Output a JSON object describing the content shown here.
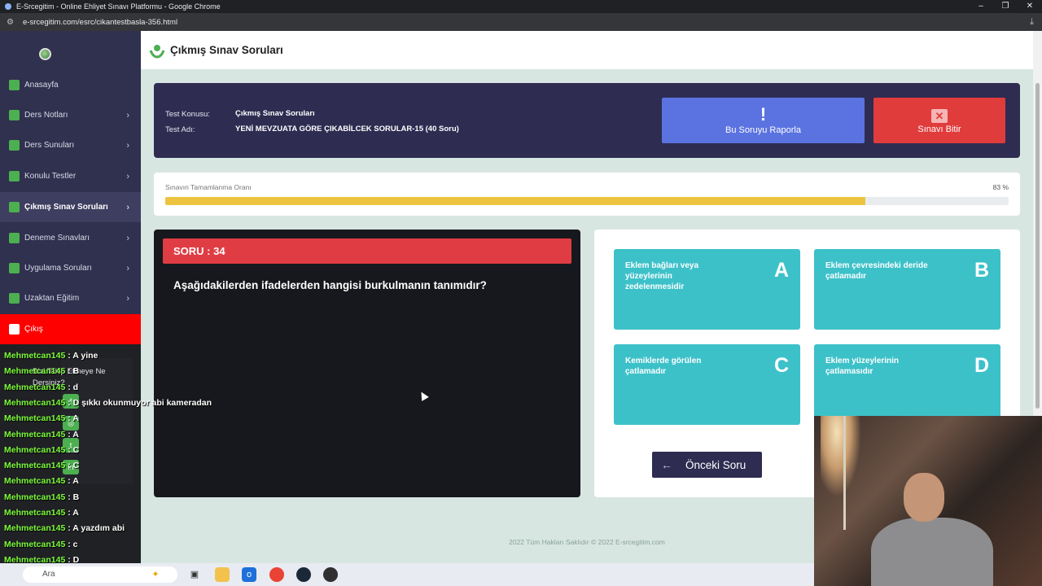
{
  "browser": {
    "window_title": "E-Srcegitim - Online Ehliyet Sınavı Platformu - Google Chrome",
    "url": "e-srcegitim.com/esrc/cikantestbasla-356.html"
  },
  "sidebar": {
    "items": [
      {
        "label": "Anasayfa",
        "icon": "home-icon",
        "color": "#4caf50"
      },
      {
        "label": "Ders Notları",
        "icon": "book-icon",
        "color": "#4caf50"
      },
      {
        "label": "Ders Sunuları",
        "icon": "presentation-icon",
        "color": "#4caf50"
      },
      {
        "label": "Konulu Testler",
        "icon": "building-icon",
        "color": "#4caf50"
      },
      {
        "label": "Çıkmış Sınav Soruları",
        "icon": "document-icon",
        "color": "#4caf50"
      },
      {
        "label": "Deneme Sınavları",
        "icon": "list-icon",
        "color": "#4caf50"
      },
      {
        "label": "Uygulama Soruları",
        "icon": "steering-icon",
        "color": "#4caf50"
      },
      {
        "label": "Uzaktan Eğitim",
        "icon": "video-icon",
        "color": "#4caf50"
      },
      {
        "label": "Çıkış",
        "icon": "logout-icon",
        "color": "#ffffff"
      }
    ]
  },
  "social": {
    "text": "Bizi Takip Etmeye Ne Dersiniz?"
  },
  "chat": {
    "messages": [
      {
        "user": "Mehmetcan145",
        "text": " : A yine"
      },
      {
        "user": "Mehmetcan145",
        "text": " : B"
      },
      {
        "user": "Mehmetcan145",
        "text": " : d"
      },
      {
        "user": "Mehmetcan145",
        "text": " : D şıkkı okunmuyor abi kameradan"
      },
      {
        "user": "Mehmetcan145",
        "text": " : A"
      },
      {
        "user": "Mehmetcan145",
        "text": " : A"
      },
      {
        "user": "Mehmetcan145",
        "text": " : C"
      },
      {
        "user": "Mehmetcan145",
        "text": " : C"
      },
      {
        "user": "Mehmetcan145",
        "text": " : A"
      },
      {
        "user": "Mehmetcan145",
        "text": " : B"
      },
      {
        "user": "Mehmetcan145",
        "text": " : A"
      },
      {
        "user": "Mehmetcan145",
        "text": " : A yazdım abi"
      },
      {
        "user": "Mehmetcan145",
        "text": " : c"
      },
      {
        "user": "Mehmetcan145",
        "text": " : D"
      },
      {
        "user": "Mehmetcan145",
        "text": " : A"
      }
    ]
  },
  "page": {
    "title": "Çıkmış Sınav Soruları"
  },
  "info": {
    "topic_label": "Test Konusu:",
    "topic_value": "Çıkmış Sınav Soruları",
    "name_label": "Test Adı:",
    "name_value": "YENİ MEVZUATA GÖRE ÇIKABİLCEK SORULAR-15 (40 Soru)",
    "report_button": "Bu Soruyu Raporla",
    "finish_button": "Sınavı Bitir"
  },
  "progress": {
    "label": "Sınavın Tamamlanma Oranı",
    "value_text": "83 %",
    "percent": 83
  },
  "question": {
    "header": "SORU : 34",
    "text": "Aşağıdakilerden ifadelerden hangisi burkulmanın tanımıdır?"
  },
  "answers": [
    {
      "letter": "A",
      "text": "Eklem bağları veya yüzeylerinin zedelenmesidir"
    },
    {
      "letter": "B",
      "text": "Eklem çevresindeki deride çatlamadır"
    },
    {
      "letter": "C",
      "text": "Kemiklerde görülen çatlamadır"
    },
    {
      "letter": "D",
      "text": "Eklem yüzeylerinin çatlamasıdır"
    }
  ],
  "prev_button": "Önceki Soru",
  "footer": "2022 Tüm Hakları Saklıdır © 2022 E-srcegitim.com",
  "taskbar": {
    "search_placeholder": "Ara"
  },
  "colors": {
    "sidebar_bg": "#30304f",
    "accent_red": "#e03c3c",
    "accent_blue": "#5a73e0",
    "answer_teal": "#3dc1c9",
    "progress_yellow": "#ecc440"
  }
}
